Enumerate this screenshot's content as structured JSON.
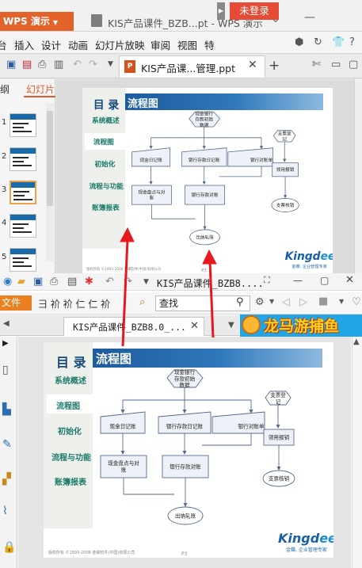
{
  "top_window": {
    "app_name": "WPS 演示",
    "title": "KIS产品课件_BZB...pt - WPS 演示",
    "menu": [
      "台",
      "插入",
      "设计",
      "动画",
      "幻灯片放映",
      "审阅",
      "视图",
      "特"
    ],
    "login_label": "未登录",
    "doc_tab": "KIS产品课...管理.ppt",
    "panel_tabs": [
      "纲",
      "幻灯片"
    ],
    "thumbnail_numbers": [
      "1",
      "2",
      "3",
      "4",
      "5"
    ],
    "selected_thumbnail": 3
  },
  "bottom_window": {
    "title": "KIS产品课件_BZB8....",
    "file_menu": "文件",
    "menu_glyphs": "彐 衸 衸 仁 仁 衸",
    "search_placeholder": "查找",
    "doc_tab": "KIS产品课件_BZB8.0_...",
    "ad_text": "龙马游捕鱼"
  },
  "slide": {
    "heading": "目 录",
    "band_title": "流程图",
    "nav": [
      "系统概述",
      "流程图",
      "初始化",
      "流程与功能",
      "账簿报表"
    ],
    "selected_nav": "流程图",
    "logo_main": "Kingd",
    "logo_tail": "ee",
    "tagline": "金蝶, 企业管理专家",
    "copyright": "版权所有 ©1993-2008 金蝶软件(中国)有限公司",
    "page": "P3",
    "flowchart": {
      "start": [
        "现金银行",
        "存款初始",
        "数据"
      ],
      "inputs": [
        "现金日记账",
        "银行存款日记账",
        "银行对账单"
      ],
      "checks": [
        "现金盘点与对",
        "账"
      ],
      "reconcile": "银行存款对账",
      "end": "出纳轧账",
      "side_start": [
        "支票登",
        "记"
      ],
      "side_use": "领用报销",
      "side_end": "支票核销"
    }
  },
  "colors": {
    "wps_orange": "#e2622a",
    "login_red": "#e64b36",
    "slide_band": "#1d5b9c",
    "nav_text": "#1a7a6a",
    "annotation_arrow": "#e8191e",
    "pdf_file_orange": "#ea8020"
  }
}
